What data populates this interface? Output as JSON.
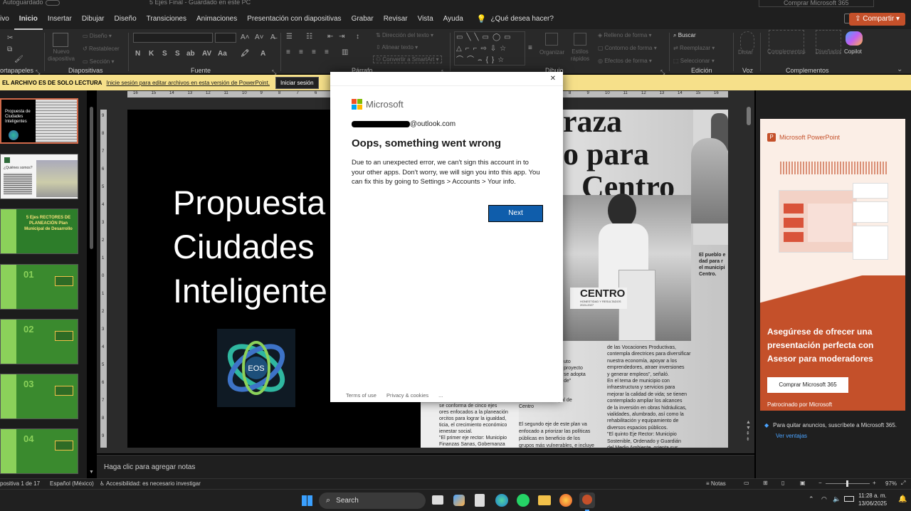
{
  "window": {
    "title": "5 Ejes Final - Guardado en este PC",
    "autosave": "Autoguardado",
    "buy": "Comprar Microsoft 365"
  },
  "menu": {
    "items": [
      "ivo",
      "Inicio",
      "Insertar",
      "Dibujar",
      "Diseño",
      "Transiciones",
      "Animaciones",
      "Presentación con diapositivas",
      "Grabar",
      "Revisar",
      "Vista",
      "Ayuda"
    ],
    "active_index": 1,
    "search": "¿Qué desea hacer?",
    "share": "Compartir"
  },
  "ribbon": {
    "groups": [
      "ortapapeles",
      "Diapositivas",
      "Fuente",
      "Párrafo",
      "Dibujo",
      "Edición",
      "Voz",
      "Complementos"
    ],
    "new_slide": "Nuevo diapositiva",
    "diseno": "Diseño",
    "restablecer": "Restablecer",
    "seccion": "Sección",
    "direccion": "Dirección del texto",
    "alinear": "Alinear texto",
    "smartart": "Convertir a SmartArt",
    "organizar": "Organizar",
    "estilos": "Estilos rápidos",
    "relleno": "Relleno de forma",
    "contorno": "Contorno de forma",
    "efectos": "Efectos de forma",
    "buscar": "Buscar",
    "reemplazar": "Reemplazar",
    "seleccionar": "Seleccionar",
    "dictar": "Dictar",
    "complementos": "Complementos",
    "disenador": "Diseñador",
    "copilot": "Copilot"
  },
  "readonly": {
    "title": "EL ARCHIVO ES DE SOLO LECTURA",
    "message": "Inicie sesión para editar archivos en esta versión de PowerPoint.",
    "button": "Iniciar sesión"
  },
  "thumbs": [
    "Propuesta de Ciudades Inteligentes",
    "¿Quiénes somos?",
    "5 Ejes RECTORES DE PLANEACIÓN Plan Municipal de Desarrollo",
    "01",
    "02",
    "03",
    "04"
  ],
  "slide": {
    "title_lines": [
      "Propuesta",
      "Ciudades",
      "Inteligente"
    ],
    "logo": "EOS",
    "news_headline": [
      "raza",
      "o para",
      "Centro"
    ],
    "news_caption": [
      "El pueblo e",
      "dad para r",
      "el municipi",
      "Centro."
    ],
    "news_col1": [
      "uto",
      "proyecto",
      "se adopta",
      "de\""
    ],
    "news_role": [
      "Presidenta Municipal de",
      "Centro"
    ],
    "news_col2": [
      "se conforma de cinco ejes",
      "ores enfocados a la planeación",
      "orcitos para lograr la igualdad,",
      "ticia, el crecimiento económico",
      "ienestar social.",
      "\"El primer eje rector: Municipio",
      "Finanzas Sanas, Gobernanza"
    ],
    "news_col3": [
      "El segundo eje de este plan va",
      "enfocado a priorizar las políticas",
      "públicas en beneficio de los",
      "grupos más vulnerables, e incluye"
    ],
    "news_col4": [
      "de las Vocaciones Productivas,",
      "contempla directrices para diversificar",
      "nuestra economía, apoyar a los",
      "emprendedores, atraer inversiones",
      "y generar empleos\", señaló.",
      "En el tema de municipio con",
      "infraestructura y servicios para",
      "mejorar la calidad de vida; se tienen",
      "contemplado ampliar los alcances",
      "de la inversión en obras hidráulicas,",
      "vialidades, alumbrado, así como la",
      "rehabilitación y equipamiento de",
      "diversos espacios públicos.",
      "\"El quinto Eje Rector: Municipio",
      "Sostenible, Ordenado y Guardián",
      "del Medio Ambiente, orienta sus"
    ],
    "centro": "CENTRO",
    "centro_sub": "HONESTIDAD Y RESULTADOS 2024-2027"
  },
  "notes": "Haga clic para agregar notas",
  "ruler_h": [
    "16",
    "15",
    "14",
    "13",
    "12",
    "11",
    "10",
    "9",
    "8",
    "7",
    "6",
    "5",
    "4",
    "3",
    "2",
    "1",
    "0",
    "1",
    "2",
    "3",
    "4",
    "5",
    "6",
    "7",
    "8",
    "9",
    "10",
    "11",
    "12",
    "13",
    "14",
    "15",
    "16"
  ],
  "ruler_v": [
    "9",
    "8",
    "7",
    "6",
    "5",
    "4",
    "3",
    "2",
    "1",
    "0",
    "1",
    "2",
    "3",
    "4",
    "5",
    "6",
    "7",
    "8",
    "9"
  ],
  "ad": {
    "brand": "Microsoft PowerPoint",
    "headline": "Asegúrese de ofrecer una presentación perfecta con Asesor para moderadores",
    "button": "Comprar Microsoft 365",
    "sponsor": "Patrocinado por Microsoft",
    "footer": "Para quitar anuncios, suscríbete a Microsoft 365.",
    "link": "Ver ventajas"
  },
  "status": {
    "slide": "positiva 1 de 17",
    "lang": "Español (México)",
    "access": "Accesibilidad: es necesario investigar",
    "notes": "Notas",
    "zoom": "97%"
  },
  "taskbar": {
    "search": "Search",
    "time": "11:28 a. m.",
    "date": "13/06/2025"
  },
  "dialog": {
    "brand": "Microsoft",
    "email": "@outlook.com",
    "title": "Oops, something went wrong",
    "body": "Due to an unexpected error, we can't sign this account in to your other apps. Don't worry, we will sign you into this app. You can fix this by going to Settings > Accounts > Your info.",
    "next": "Next",
    "terms": "Terms of use",
    "privacy": "Privacy & cookies",
    "more": "...",
    "close": "✕"
  },
  "colors": {
    "accent": "#c4502a",
    "next": "#0f5dab",
    "readonly": "#f6e08a",
    "green": "#3a8a2e"
  }
}
